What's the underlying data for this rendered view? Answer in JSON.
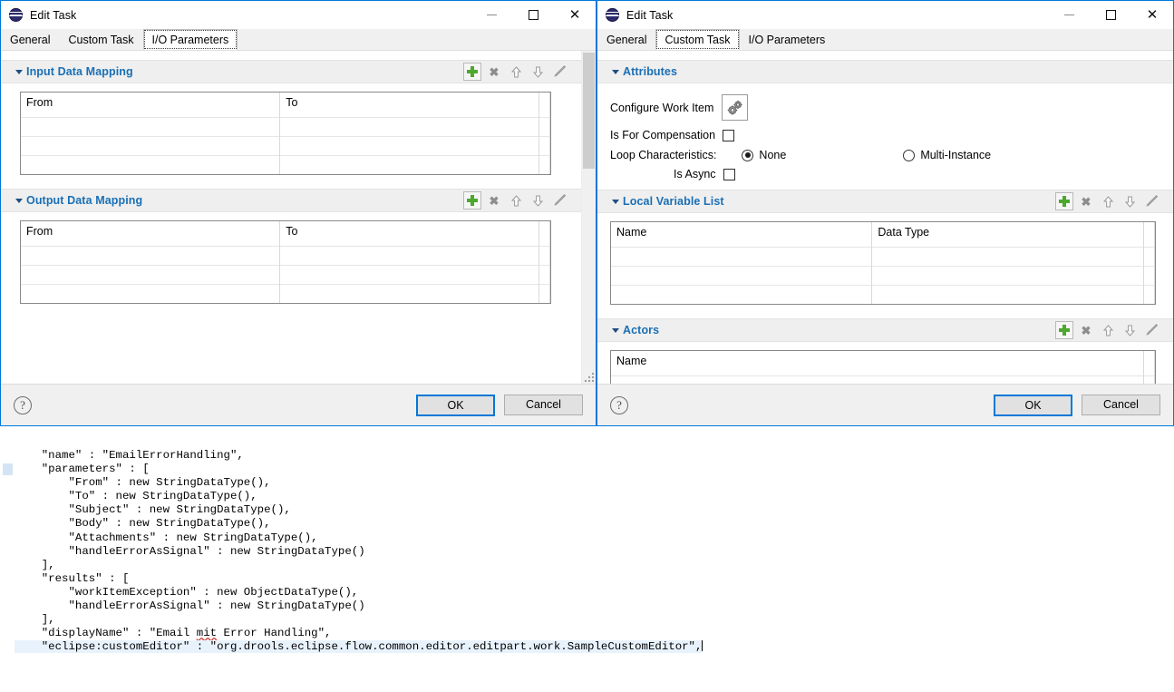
{
  "window_left": {
    "title": "Edit Task",
    "icon": "drools-globe-icon",
    "controls": {
      "minimize": "minimize-icon",
      "maximize": "maximize-icon",
      "close": "close-icon"
    },
    "tabs": [
      {
        "label": "General",
        "selected": false
      },
      {
        "label": "Custom Task",
        "selected": false
      },
      {
        "label": "I/O Parameters",
        "selected": true
      }
    ],
    "sections": [
      {
        "title": "Input Data Mapping",
        "expanded": true,
        "tools": [
          "add-icon",
          "delete-icon",
          "move-up-icon",
          "move-down-icon",
          "edit-icon"
        ],
        "columns": [
          "From",
          "To"
        ],
        "rows": []
      },
      {
        "title": "Output Data Mapping",
        "expanded": true,
        "tools": [
          "add-icon",
          "delete-icon",
          "move-up-icon",
          "move-down-icon",
          "edit-icon"
        ],
        "columns": [
          "From",
          "To"
        ],
        "rows": []
      }
    ],
    "footer": {
      "help": "?",
      "ok_label": "OK",
      "cancel_label": "Cancel"
    }
  },
  "window_right": {
    "title": "Edit Task",
    "icon": "drools-globe-icon",
    "controls": {
      "minimize": "minimize-icon",
      "maximize": "maximize-icon",
      "close": "close-icon"
    },
    "tabs": [
      {
        "label": "General",
        "selected": false
      },
      {
        "label": "Custom Task",
        "selected": true
      },
      {
        "label": "I/O Parameters",
        "selected": false
      }
    ],
    "attributes": {
      "title": "Attributes",
      "expanded": true,
      "configure_work_item_label": "Configure Work Item",
      "configure_work_item_icon": "gears-icon",
      "is_for_compensation_label": "Is For Compensation",
      "is_for_compensation_checked": false,
      "loop_characteristics_label": "Loop Characteristics:",
      "loop_none_label": "None",
      "loop_none_selected": true,
      "loop_multi_label": "Multi-Instance",
      "loop_multi_selected": false,
      "is_async_label": "Is Async",
      "is_async_checked": false
    },
    "local_variable_list": {
      "title": "Local Variable List",
      "expanded": true,
      "tools": [
        "add-icon",
        "delete-icon",
        "move-up-icon",
        "move-down-icon",
        "edit-icon"
      ],
      "columns": [
        "Name",
        "Data Type"
      ],
      "rows": []
    },
    "actors": {
      "title": "Actors",
      "expanded": true,
      "tools": [
        "add-icon",
        "delete-icon",
        "move-up-icon",
        "move-down-icon",
        "edit-icon"
      ],
      "columns": [
        "Name"
      ],
      "rows": []
    },
    "footer": {
      "help": "?",
      "ok_label": "OK",
      "cancel_label": "Cancel"
    }
  },
  "editor": {
    "lines": [
      "    \"name\" : \"EmailErrorHandling\",",
      "    \"parameters\" : [",
      "        \"From\" : new StringDataType(),",
      "        \"To\" : new StringDataType(),",
      "        \"Subject\" : new StringDataType(),",
      "        \"Body\" : new StringDataType(),",
      "        \"Attachments\" : new StringDataType(),",
      "        \"handleErrorAsSignal\" : new StringDataType()",
      "    ],",
      "    \"results\" : [",
      "        \"workItemException\" : new ObjectDataType(),",
      "        \"handleErrorAsSignal\" : new StringDataType()",
      "    ],",
      "    \"displayName\" : \"Email mit Error Handling\",",
      "    \"eclipse:customEditor\" : \"org.drools.eclipse.flow.common.editor.editpart.work.SampleCustomEditor\","
    ],
    "highlighted_line_index": 14,
    "misspelled_word": "mit",
    "marker_line_index": 1,
    "caret_after_last_line": true
  },
  "colors": {
    "accent": "#0078d7",
    "section_title": "#1a6fb5",
    "add_icon_green": "#4ea72e",
    "highlight": "#e8f2fc",
    "dialog_bg": "#f0f0f0"
  }
}
